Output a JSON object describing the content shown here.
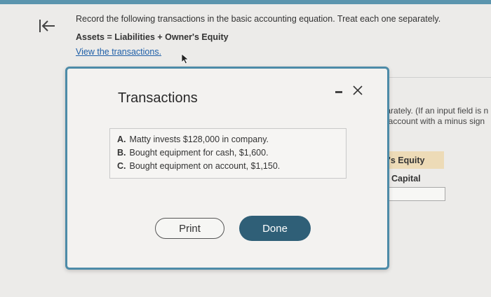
{
  "colors": {
    "accent": "#4d8ba8",
    "done_button": "#2f5f77",
    "link": "#1f5fa8",
    "equity_header": "#eddbb7"
  },
  "back_icon": "back-to-start-icon",
  "question": {
    "instruction": "Record the following transactions in the basic accounting equation. Treat each one separately.",
    "equation": "Assets = Liabilities + Owner's Equity",
    "link_text": "View the transactions."
  },
  "background": {
    "note_line1": "eparately. (If an input field is n",
    "note_line2": "an account with a minus sign",
    "equity_header": "r's Equity",
    "capital_label": "y, Capital"
  },
  "modal": {
    "title": "Transactions",
    "minimize_icon": "minimize-icon",
    "close_icon": "close-icon",
    "transactions": [
      {
        "letter": "A.",
        "text": "Matty invests $128,000 in company."
      },
      {
        "letter": "B.",
        "text": "Bought equipment for cash, $1,600."
      },
      {
        "letter": "C.",
        "text": "Bought equipment on account, $1,150."
      }
    ],
    "print_label": "Print",
    "done_label": "Done"
  }
}
